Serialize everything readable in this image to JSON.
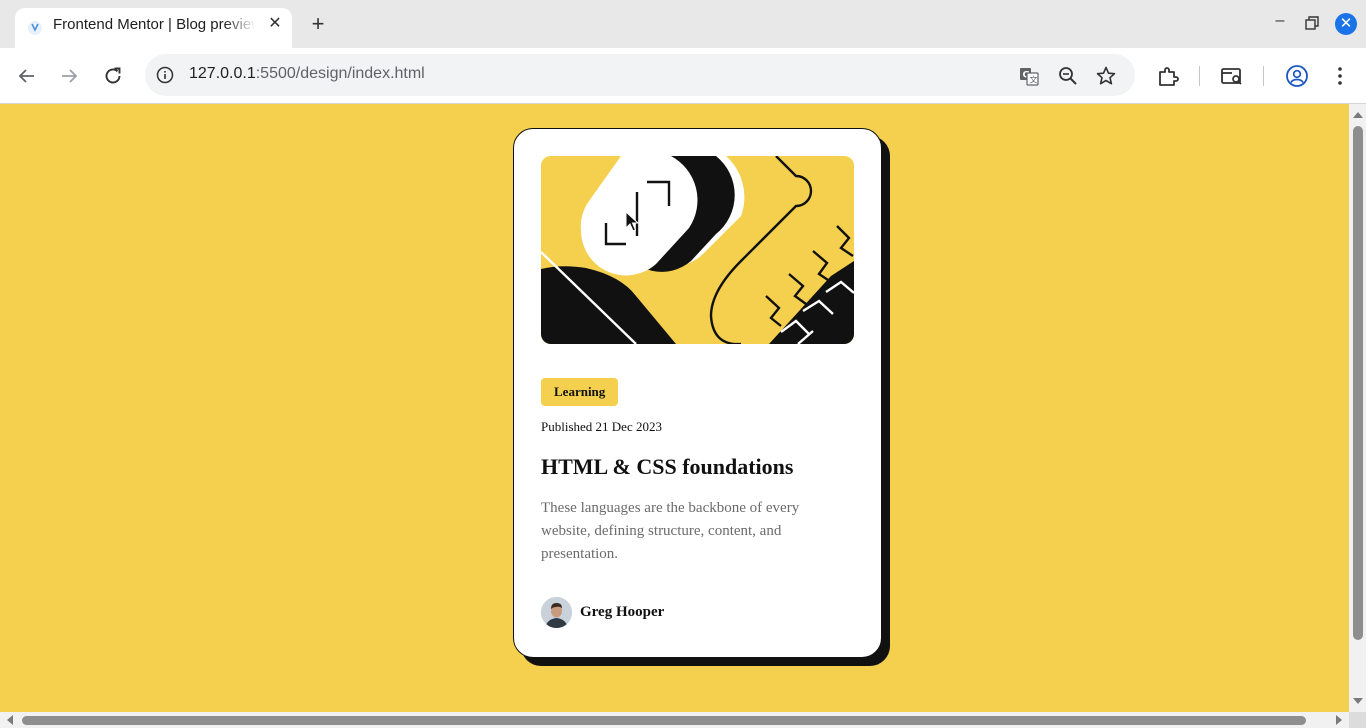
{
  "browser": {
    "tab_title": "Frontend Mentor | Blog preview card",
    "url_host": "127.0.0.1",
    "url_rest": ":5500/design/index.html",
    "close_tab_glyph": "✕",
    "new_tab_glyph": "+",
    "minimize_glyph": "–",
    "close_window_glyph": "✕"
  },
  "card": {
    "image_alt": "illustration-article",
    "tag": "Learning",
    "published": "Published 21 Dec 2023",
    "title": "HTML & CSS foundations",
    "description": "These languages are the backbone of every website, defining structure, content, and presentation.",
    "author": "Greg Hooper"
  },
  "colors": {
    "page_bg": "#f4d04e",
    "card_bg": "#ffffff",
    "ink": "#111111",
    "muted": "#6b6b6b"
  },
  "icons": [
    "back-arrow-icon",
    "forward-arrow-icon",
    "reload-icon",
    "site-info-icon",
    "translate-icon",
    "zoom-icon",
    "bookmark-star-icon",
    "extensions-icon",
    "tab-search-icon",
    "profile-icon",
    "menu-icon"
  ]
}
